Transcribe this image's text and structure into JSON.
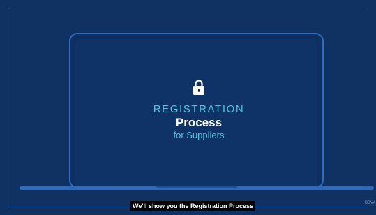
{
  "video": {
    "heading_line1": "REGISTRATION",
    "heading_line2": "Process",
    "heading_line3": "for Suppliers",
    "caption": "We'll show you the Registration Process",
    "watermark": "BBVA"
  },
  "icons": {
    "lock": "lock-icon"
  },
  "colors": {
    "background": "#0f3263",
    "accent_cyan": "#4ec6e0",
    "outline_blue": "#2d6dc2",
    "text_white": "#ffffff"
  }
}
